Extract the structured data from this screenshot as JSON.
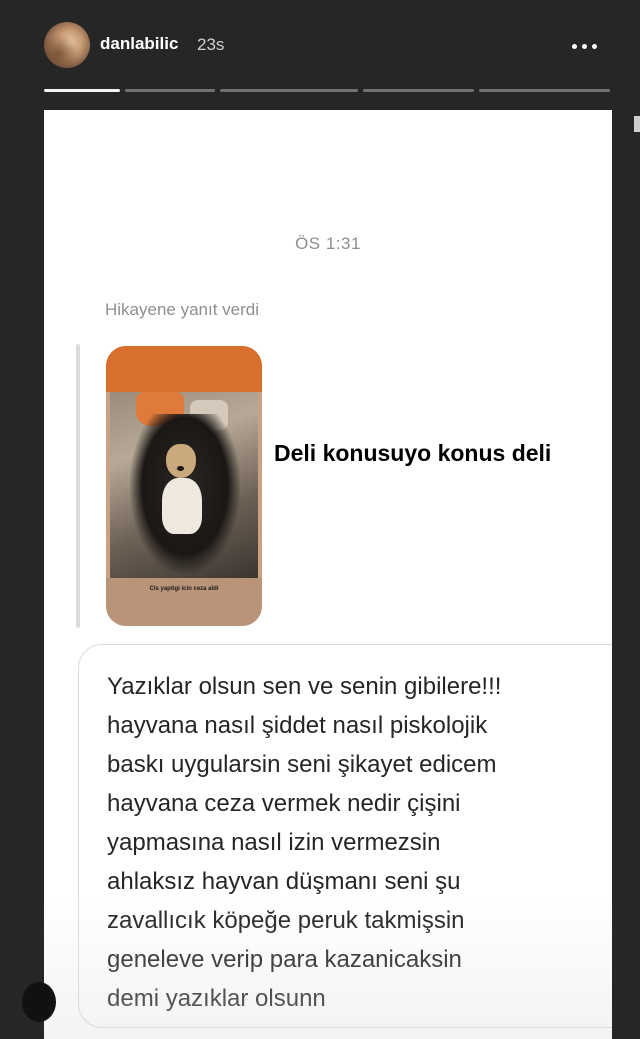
{
  "header": {
    "username": "danlabilic",
    "time_ago": "23s",
    "more_icon": "more-horizontal-icon",
    "progress": {
      "segments": 5,
      "active_index": 0
    }
  },
  "dm": {
    "timestamp": "ÖS 1:31",
    "reply_note": "Hikayene yanıt verdi",
    "story_preview": {
      "caption": "Cis yaptigi icin ceza aldi",
      "text": "Deli konusuyo konus deli"
    },
    "message": "Yazıklar olsun sen ve senin gibilere!!!\nhayvana nasıl şiddet nasıl piskolojik\nbaskı uygularsin seni şikayet edicem\nhayvana ceza vermek nedir çişini\nyapmasına nasıl izin vermezsin\nahlaksız hayvan düşmanı seni şu\nzavallıcık köpeğe peruk takmişsin\ngeneleve verip para kazanicaksin\ndemi yazıklar olsunn"
  },
  "colors": {
    "background": "#262626",
    "card": "#ffffff",
    "muted_text": "#8e8e8e",
    "bubble_border": "#dbdbdb"
  }
}
